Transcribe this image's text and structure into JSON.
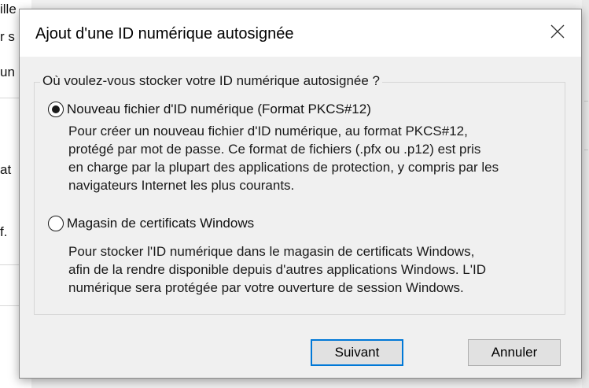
{
  "background": {
    "fragments": [
      "ille",
      "r s",
      "un",
      "at",
      "f."
    ]
  },
  "dialog": {
    "title": "Ajout d'une ID numérique autosignée",
    "close_icon": "close-icon",
    "question": "Où voulez-vous stocker votre ID numérique autosignée ?",
    "options": [
      {
        "label": "Nouveau fichier d'ID numérique (Format PKCS#12)",
        "selected": true,
        "description": [
          "Pour créer un nouveau fichier d'ID numérique, au format PKCS#12,",
          "protégé par mot de passe. Ce format de fichiers (.pfx ou .p12) est pris",
          "en charge par la plupart des applications de protection, y compris par les",
          "navigateurs Internet les plus courants."
        ]
      },
      {
        "label": "Magasin de certificats Windows",
        "selected": false,
        "description": [
          "Pour stocker l'ID numérique dans le magasin de certificats Windows,",
          "afin de la rendre disponible depuis d'autres applications Windows. L'ID",
          "numérique sera protégée par votre ouverture de session Windows."
        ]
      }
    ],
    "buttons": {
      "next": "Suivant",
      "cancel": "Annuler"
    },
    "colors": {
      "accent": "#0078d7",
      "face": "#f0f0f0",
      "button": "#e1e1e1"
    }
  }
}
